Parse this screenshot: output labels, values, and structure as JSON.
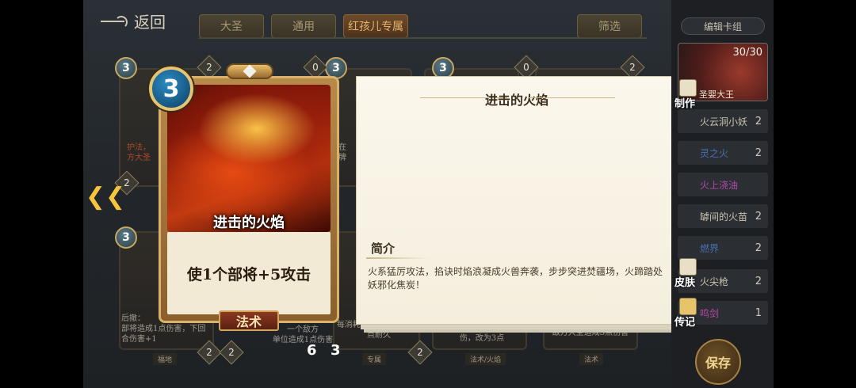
{
  "nav": {
    "back_label": "返回"
  },
  "tabs": [
    {
      "label": "大圣"
    },
    {
      "label": "通用"
    },
    {
      "label": "红孩儿专属"
    }
  ],
  "filter_label": "筛选",
  "background_cards": [
    {
      "cost": "3",
      "count": "2",
      "text": "护法，\n方大圣"
    },
    {
      "cost": "3",
      "count": "0",
      "text": "在\n牌"
    },
    {
      "cost": "3",
      "count": "0",
      "text": ""
    },
    {
      "cost": "3",
      "count": "2",
      "text": ""
    }
  ],
  "bottom_cards": [
    {
      "text": "后撤：\n部将造成1点伤害，下回合伤害+1",
      "tag": "福地",
      "count": "2"
    },
    {
      "text": "一个敌方\n单位造成1点伤害",
      "tag": "",
      "count": "2"
    },
    {
      "text": "每消耗一个部将，恢复1点耐久",
      "tag": "专属",
      "count": "2"
    },
    {
      "text": "成2点伤害，若目标未受伤，改为3点",
      "tag": "法术/火焰",
      "count": ""
    },
    {
      "text": "敌方大圣造成3点伤害",
      "tag": "法术",
      "count": ""
    }
  ],
  "mid_left_badge": "2",
  "mid_cost_badge": "3",
  "bottom_extra": {
    "six": "6",
    "three": "3"
  },
  "featured_card": {
    "cost": "3",
    "name": "进击的火焰",
    "description": "使1个部将+5攻击",
    "type": "法术"
  },
  "info_panel": {
    "title": "进击的火焰",
    "intro_label": "简介",
    "intro_text": "火系猛厉攻法，掐诀时焰浪凝成火兽奔袭，步步突进焚疆场，火蹄踏处妖邪化焦炭！"
  },
  "deck": {
    "header": "编辑卡组",
    "hero_count": "30/30",
    "hero_name": "圣婴大王",
    "items": [
      {
        "label": "火云洞小妖",
        "count": "2",
        "color": "#c9c1ae"
      },
      {
        "label": "灵之火",
        "count": "2",
        "color": "#4a6fb0"
      },
      {
        "label": "火上浇油",
        "count": "",
        "color": "#b04aa8"
      },
      {
        "label": "罅间的火苗",
        "count": "2",
        "color": "#c9c1ae"
      },
      {
        "label": "燃界",
        "count": "2",
        "color": "#4a6fb0"
      },
      {
        "label": "火尖枪",
        "count": "2",
        "color": "#c9c1ae"
      },
      {
        "label": "鸣剑",
        "count": "1",
        "color": "#b04aa8"
      }
    ]
  },
  "side_actions": {
    "make": "制作",
    "skin": "皮肤",
    "legend": "传记"
  },
  "save_label": "保存",
  "colors": {
    "accent_gold": "#f6c53e",
    "panel_bg": "#fbf7ec",
    "card_frame": "#d8b26a"
  }
}
